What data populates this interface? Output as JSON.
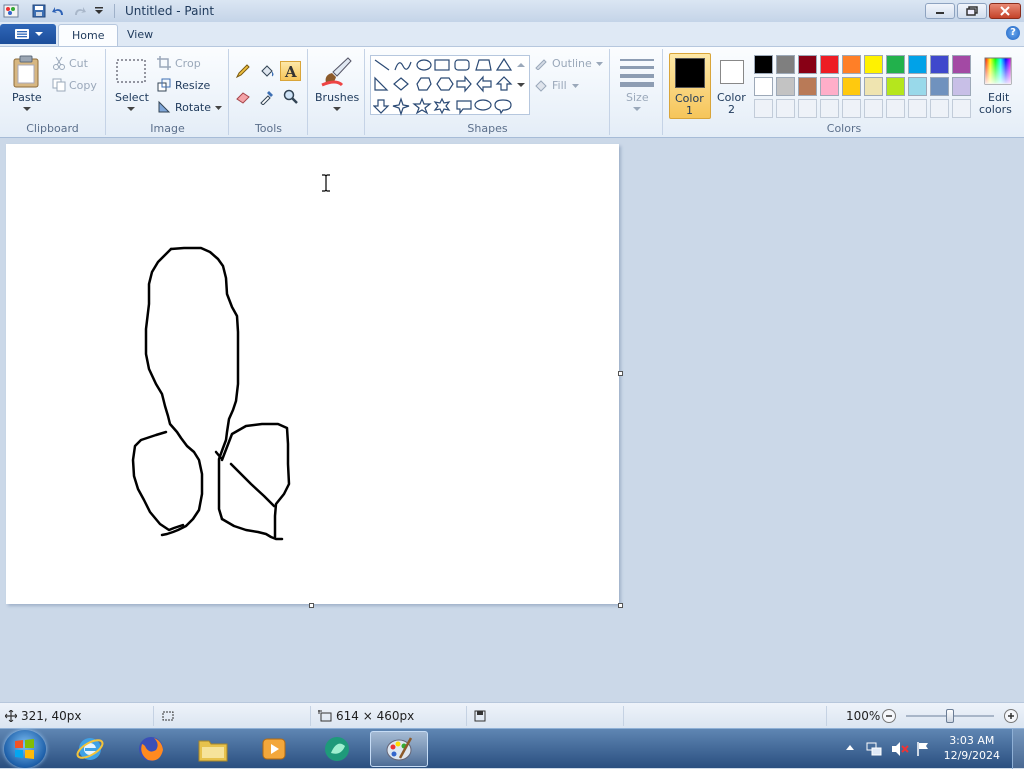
{
  "window": {
    "title": "Untitled - Paint"
  },
  "tabs": {
    "home": "Home",
    "view": "View"
  },
  "clipboard": {
    "paste": "Paste",
    "cut": "Cut",
    "copy": "Copy",
    "group": "Clipboard"
  },
  "image": {
    "select": "Select",
    "crop": "Crop",
    "resize": "Resize",
    "rotate": "Rotate",
    "group": "Image"
  },
  "tools": {
    "group": "Tools"
  },
  "brushes": {
    "label": "Brushes"
  },
  "shapes": {
    "outline": "Outline",
    "fill": "Fill",
    "group": "Shapes"
  },
  "size": {
    "label": "Size"
  },
  "colors": {
    "color1_line1": "Color",
    "color1_line2": "1",
    "color2_line1": "Color",
    "color2_line2": "2",
    "edit_line1": "Edit",
    "edit_line2": "colors",
    "group": "Colors",
    "color1_value": "#000000",
    "color2_value": "#ffffff",
    "palette_row1": [
      "#000000",
      "#7f7f7f",
      "#880015",
      "#ed1c24",
      "#ff7f27",
      "#fff200",
      "#22b14c",
      "#00a2e8",
      "#3f48cc",
      "#a349a4"
    ],
    "palette_row2": [
      "#ffffff",
      "#c3c3c3",
      "#b97a57",
      "#ffaec9",
      "#ffc90e",
      "#efe4b0",
      "#b5e61d",
      "#99d9ea",
      "#7092be",
      "#c8bfe7"
    ]
  },
  "status": {
    "cursor_pos": "321, 40px",
    "canvas_size": "614 × 460px",
    "zoom": "100%",
    "zoom_level": 1.0
  },
  "clock": {
    "time": "3:03 AM",
    "date": "12/9/2024"
  }
}
